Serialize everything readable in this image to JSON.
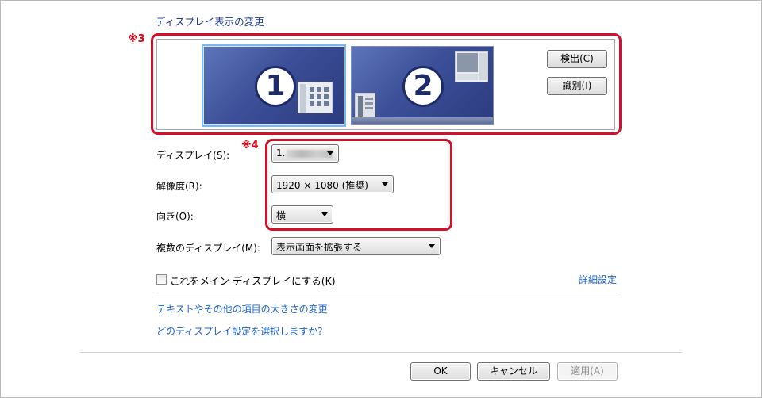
{
  "dialog": {
    "heading": "ディスプレイ表示の変更"
  },
  "annotations": {
    "marker_3": "※3",
    "marker_4": "※4",
    "highlight_color": "#d3112a"
  },
  "preview": {
    "monitors": [
      {
        "number": "1",
        "selected": true
      },
      {
        "number": "2",
        "selected": false
      }
    ],
    "detect_button": "検出(C)",
    "identify_button": "識別(I)"
  },
  "settings": {
    "display": {
      "label": "ディスプレイ(S):",
      "value": "1."
    },
    "resolution": {
      "label": "解像度(R):",
      "value": "1920 × 1080 (推奨)"
    },
    "orientation": {
      "label": "向き(O):",
      "value": "横"
    },
    "multiple_displays": {
      "label": "複数のディスプレイ(M):",
      "value": "表示画面を拡張する"
    }
  },
  "main_display_checkbox": {
    "label": "これをメイン ディスプレイにする(K)",
    "checked": false
  },
  "links": {
    "advanced_settings": "詳細設定",
    "text_size": "テキストやその他の項目の大きさの変更",
    "which_settings": "どのディスプレイ設定を選択しますか?"
  },
  "footer": {
    "ok_button": "OK",
    "cancel_button": "キャンセル",
    "apply_button": "適用(A)"
  }
}
